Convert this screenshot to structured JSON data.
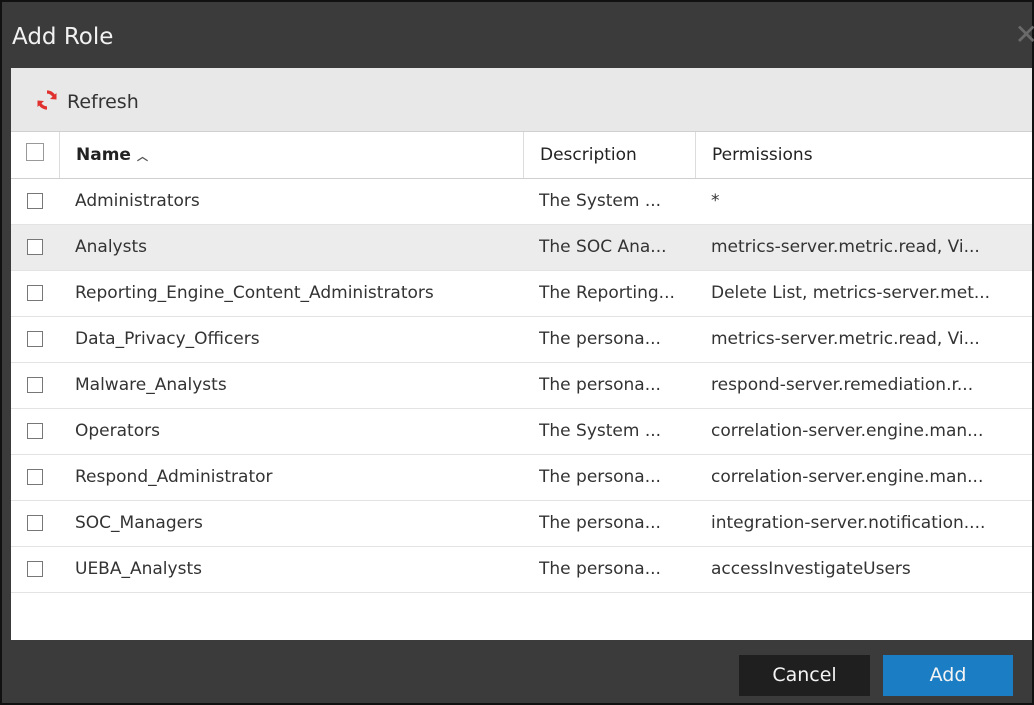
{
  "dialog": {
    "title": "Add Role",
    "close_icon": "close-icon"
  },
  "toolbar": {
    "refresh_label": "Refresh",
    "refresh_icon": "refresh-icon",
    "accent": "#e0312e"
  },
  "table": {
    "columns": {
      "name": "Name",
      "name_sort": "^",
      "description": "Description",
      "permissions": "Permissions"
    },
    "rows": [
      {
        "name": "Administrators",
        "description": "The System ...",
        "permissions": "*"
      },
      {
        "name": "Analysts",
        "description": "The SOC Ana...",
        "permissions": "metrics-server.metric.read, Vi..."
      },
      {
        "name": "Reporting_Engine_Content_Administrators",
        "description": "The Reporting...",
        "permissions": "Delete List, metrics-server.met..."
      },
      {
        "name": "Data_Privacy_Officers",
        "description": "The persona...",
        "permissions": "metrics-server.metric.read, Vi..."
      },
      {
        "name": "Malware_Analysts",
        "description": "The persona...",
        "permissions": "respond-server.remediation.r..."
      },
      {
        "name": "Operators",
        "description": "The System ...",
        "permissions": "correlation-server.engine.man..."
      },
      {
        "name": "Respond_Administrator",
        "description": "The persona...",
        "permissions": "correlation-server.engine.man..."
      },
      {
        "name": "SOC_Managers",
        "description": "The persona...",
        "permissions": "integration-server.notification...."
      },
      {
        "name": "UEBA_Analysts",
        "description": "The persona...",
        "permissions": "accessInvestigateUsers"
      }
    ]
  },
  "footer": {
    "cancel_label": "Cancel",
    "add_label": "Add",
    "add_color": "#1b7ec4"
  }
}
